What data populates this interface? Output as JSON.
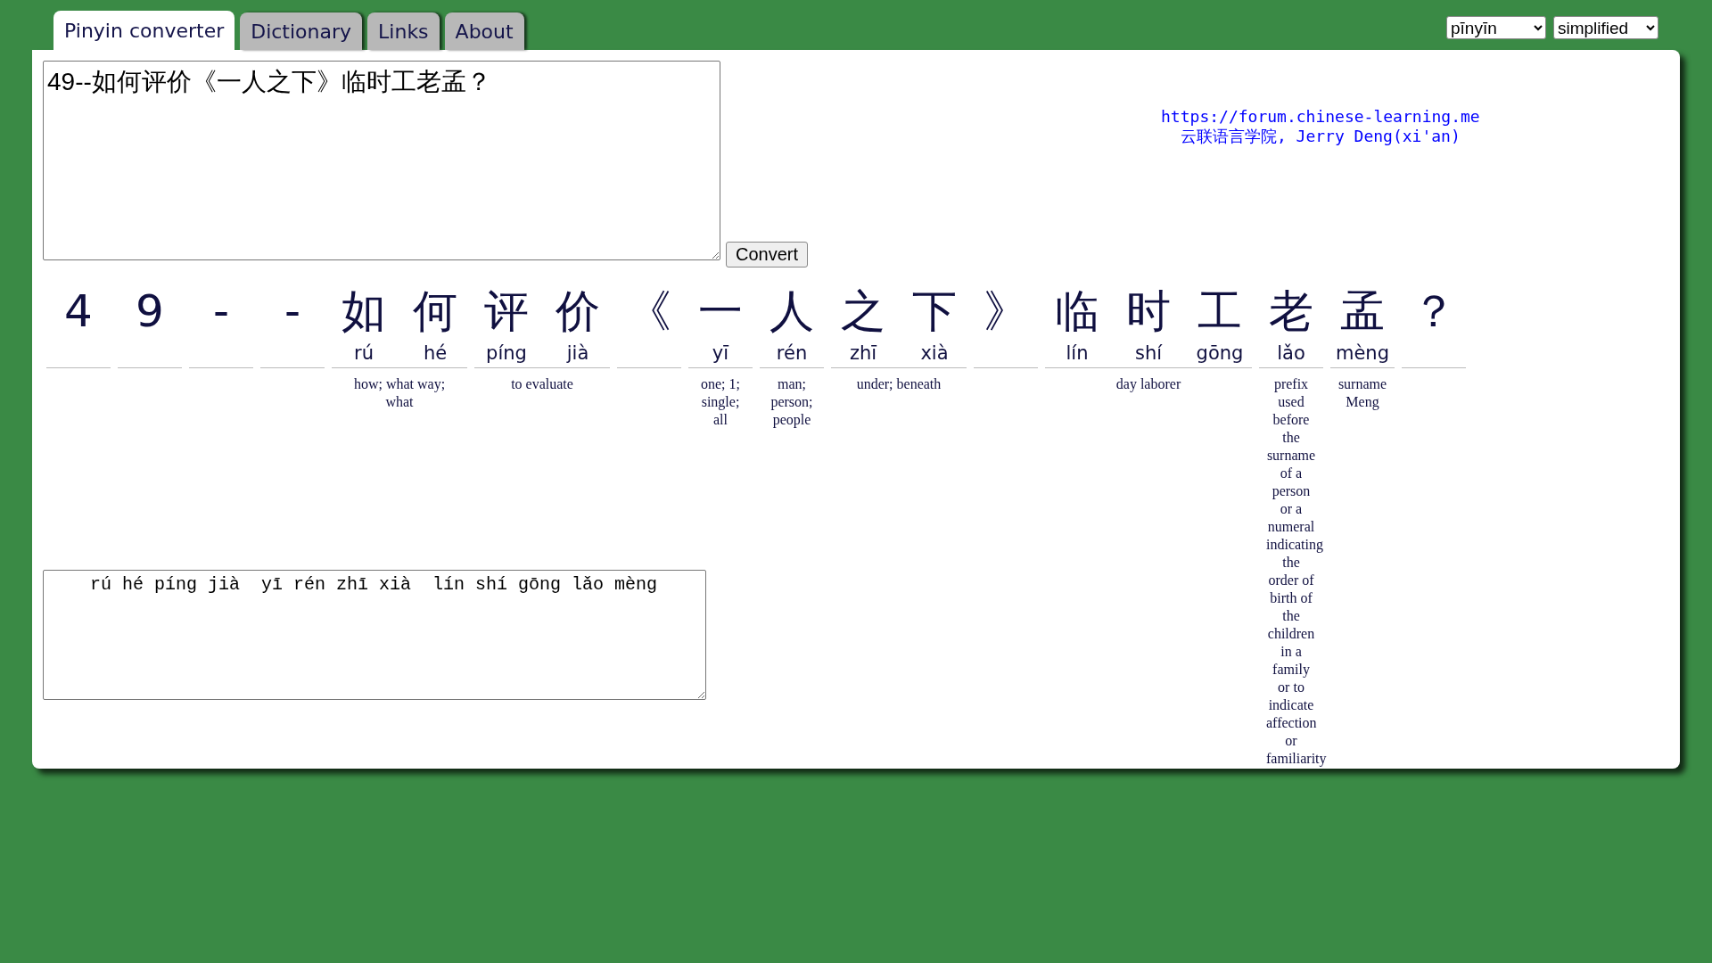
{
  "tabs": [
    {
      "label": "Pinyin converter",
      "selected": true
    },
    {
      "label": "Dictionary",
      "selected": false
    },
    {
      "label": "Links",
      "selected": false
    },
    {
      "label": "About",
      "selected": false
    }
  ],
  "settings": {
    "romanization": "pīnyīn",
    "script": "simplified"
  },
  "input": {
    "value": "49--如何评价《一人之下》临时工老孟？"
  },
  "convert_button": "Convert",
  "credits": {
    "link": "https://forum.chinese-learning.me",
    "author": "云联语言学院, Jerry Deng(xi'an)"
  },
  "words": [
    {
      "chars": [
        {
          "char": "4"
        }
      ]
    },
    {
      "chars": [
        {
          "char": "9"
        }
      ]
    },
    {
      "chars": [
        {
          "char": "-"
        }
      ]
    },
    {
      "chars": [
        {
          "char": "-"
        }
      ]
    },
    {
      "chars": [
        {
          "char": "如",
          "pinyin": "rú"
        },
        {
          "char": "何",
          "pinyin": "hé"
        }
      ],
      "definition": "how; what way; what"
    },
    {
      "chars": [
        {
          "char": "评",
          "pinyin": "píng"
        },
        {
          "char": "价",
          "pinyin": "jià"
        }
      ],
      "definition": "to evaluate"
    },
    {
      "chars": [
        {
          "char": "《"
        }
      ]
    },
    {
      "chars": [
        {
          "char": "一",
          "pinyin": "yī"
        }
      ],
      "definition": "one; 1; single; all"
    },
    {
      "chars": [
        {
          "char": "人",
          "pinyin": "rén"
        }
      ],
      "definition": "man; person; people"
    },
    {
      "chars": [
        {
          "char": "之",
          "pinyin": "zhī"
        },
        {
          "char": "下",
          "pinyin": "xià"
        }
      ],
      "definition": "under; beneath"
    },
    {
      "chars": [
        {
          "char": "》"
        }
      ]
    },
    {
      "chars": [
        {
          "char": "临",
          "pinyin": "lín"
        },
        {
          "char": "时",
          "pinyin": "shí"
        },
        {
          "char": "工",
          "pinyin": "gōng"
        }
      ],
      "definition": "day laborer"
    },
    {
      "chars": [
        {
          "char": "老",
          "pinyin": "lǎo"
        }
      ],
      "definition": "prefix used before the surname of a person or a numeral indicating the order of birth of the children in a family or to indicate affection or familiarity"
    },
    {
      "chars": [
        {
          "char": "孟",
          "pinyin": "mèng"
        }
      ],
      "definition": "surname Meng"
    },
    {
      "chars": [
        {
          "char": "？"
        }
      ]
    }
  ],
  "output": {
    "value": "rú hé píng jià  yī rén zhī xià  lín shí gōng lǎo mèng"
  }
}
